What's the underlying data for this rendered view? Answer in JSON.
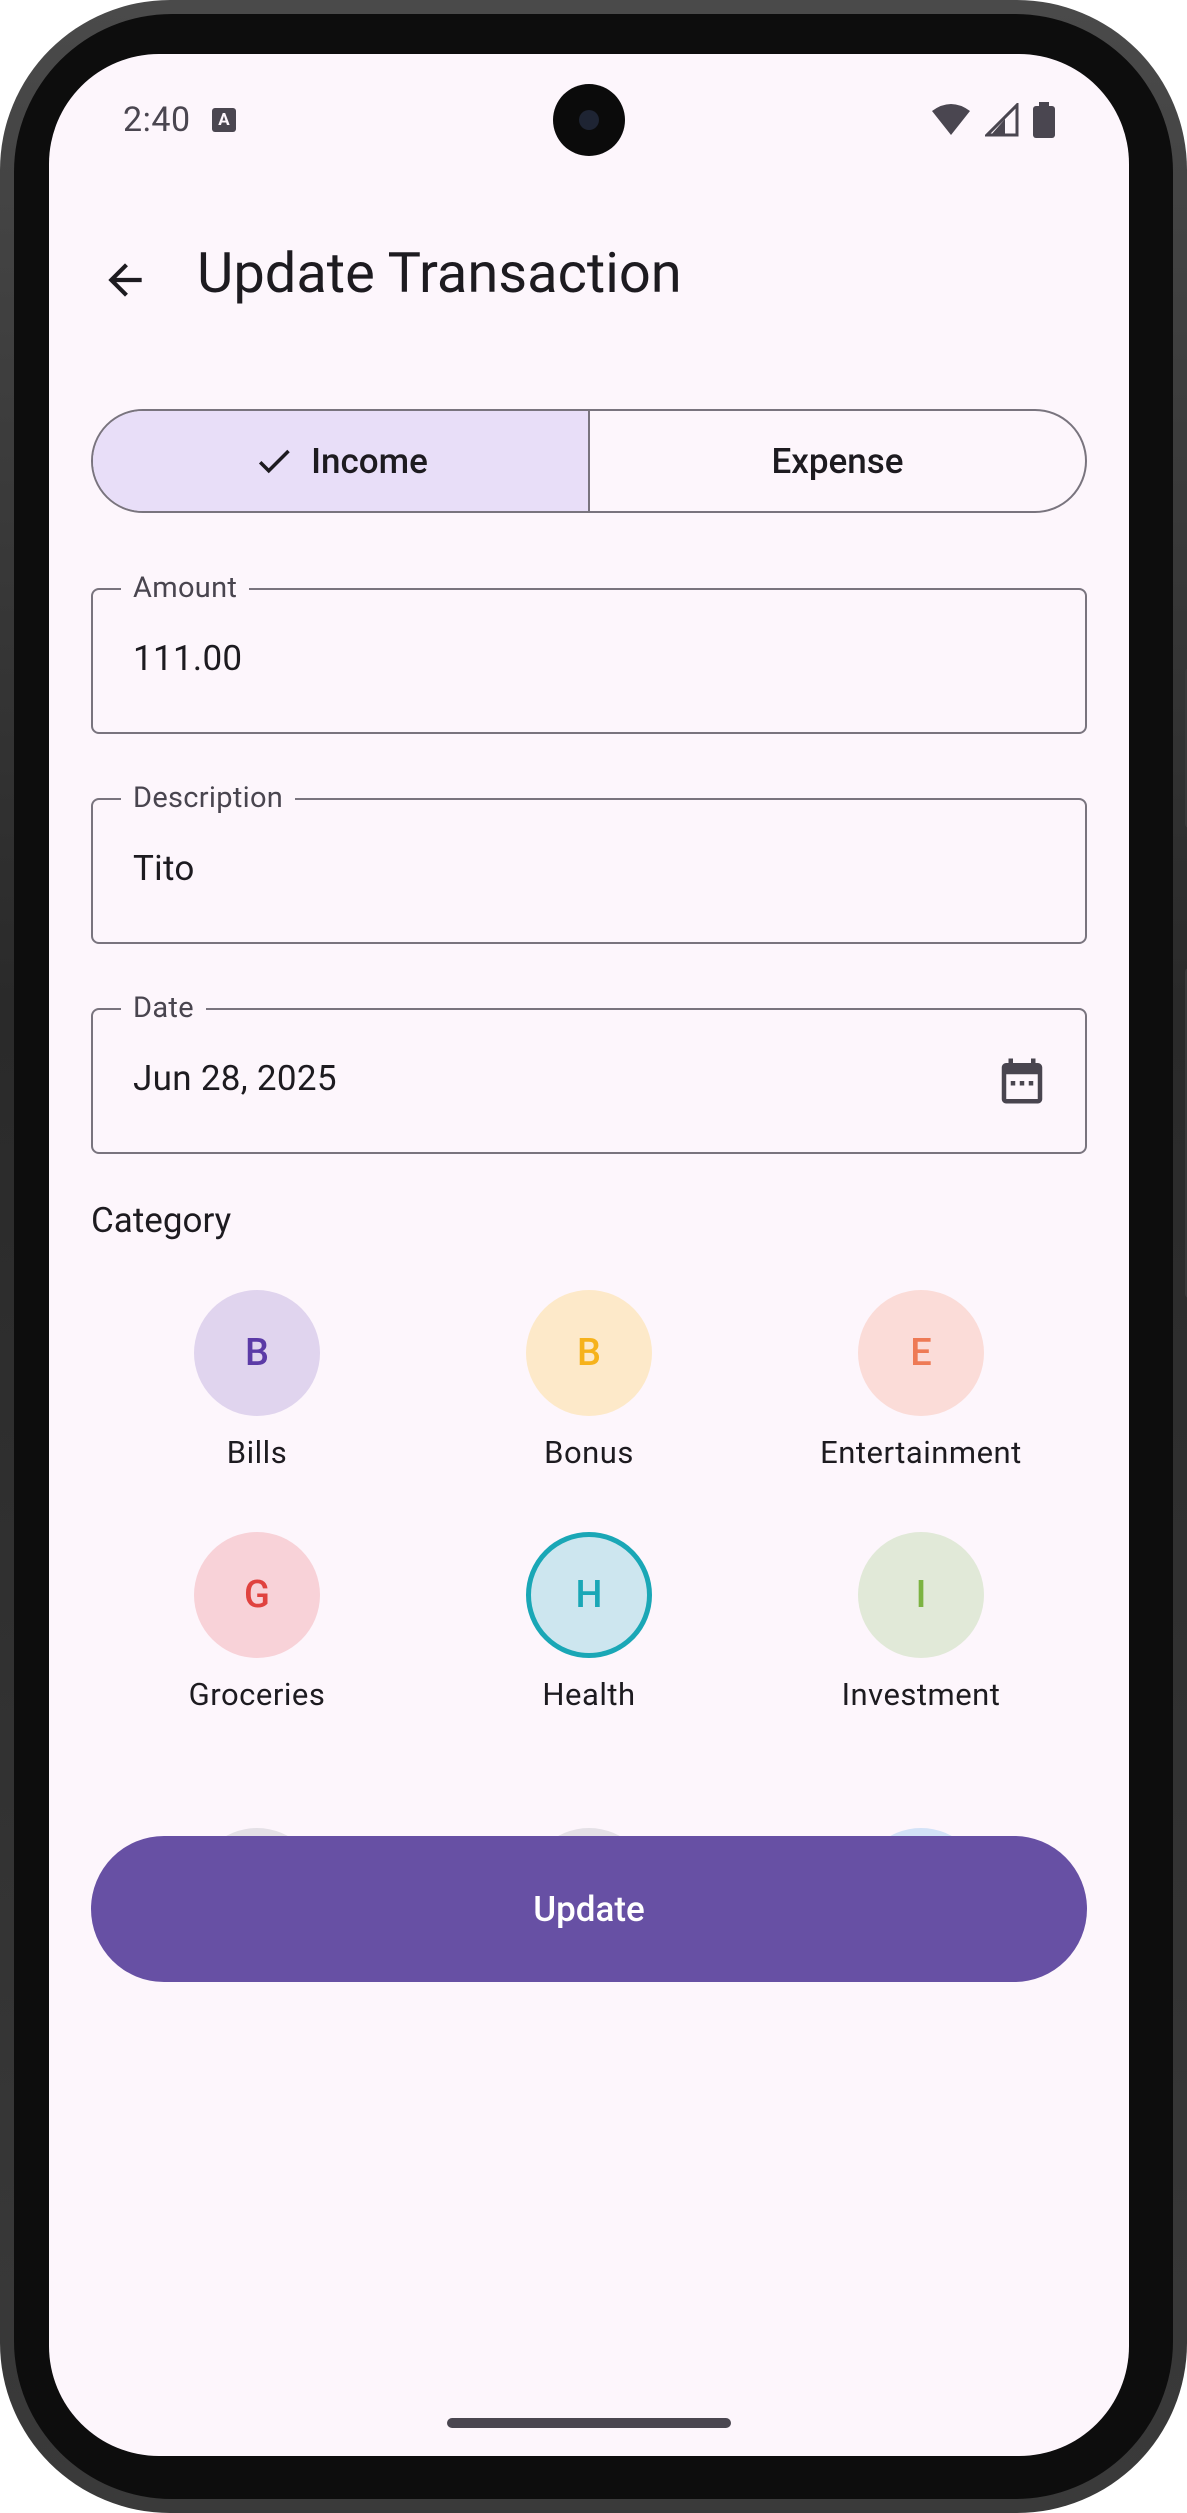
{
  "status_bar": {
    "time": "2:40",
    "notification_icon_letter": "A"
  },
  "app_bar": {
    "title": "Update Transaction"
  },
  "type_toggle": {
    "options": [
      {
        "label": "Income",
        "selected": true
      },
      {
        "label": "Expense",
        "selected": false
      }
    ]
  },
  "form": {
    "amount": {
      "label": "Amount",
      "value": "111.00"
    },
    "description": {
      "label": "Description",
      "value": "Tito"
    },
    "date": {
      "label": "Date",
      "value": "Jun 28, 2025"
    }
  },
  "category": {
    "heading": "Category",
    "items": [
      {
        "letter": "B",
        "name": "Bills",
        "bg": "#e0d4ee",
        "fg": "#5b3aa6",
        "selected": false
      },
      {
        "letter": "B",
        "name": "Bonus",
        "bg": "#fde9c9",
        "fg": "#f6b21b",
        "selected": false
      },
      {
        "letter": "E",
        "name": "Entertainment",
        "bg": "#fbdcd8",
        "fg": "#ee7a55",
        "selected": false
      },
      {
        "letter": "G",
        "name": "Groceries",
        "bg": "#f8d2d8",
        "fg": "#e0423f",
        "selected": false
      },
      {
        "letter": "H",
        "name": "Health",
        "bg": "#cde6ef",
        "fg": "#1aa7b6",
        "selected": true
      },
      {
        "letter": "I",
        "name": "Investment",
        "bg": "#e1e9d8",
        "fg": "#7cb342",
        "selected": false
      }
    ],
    "partially_visible_row_colors": [
      "#e4e0e6",
      "#e4e0e6",
      "#d3e2f7"
    ]
  },
  "actions": {
    "update_label": "Update"
  },
  "colors": {
    "primary": "#6750a4",
    "selected_segment": "#e8def8",
    "background": "#fdf6fc",
    "outline": "#79747e"
  }
}
